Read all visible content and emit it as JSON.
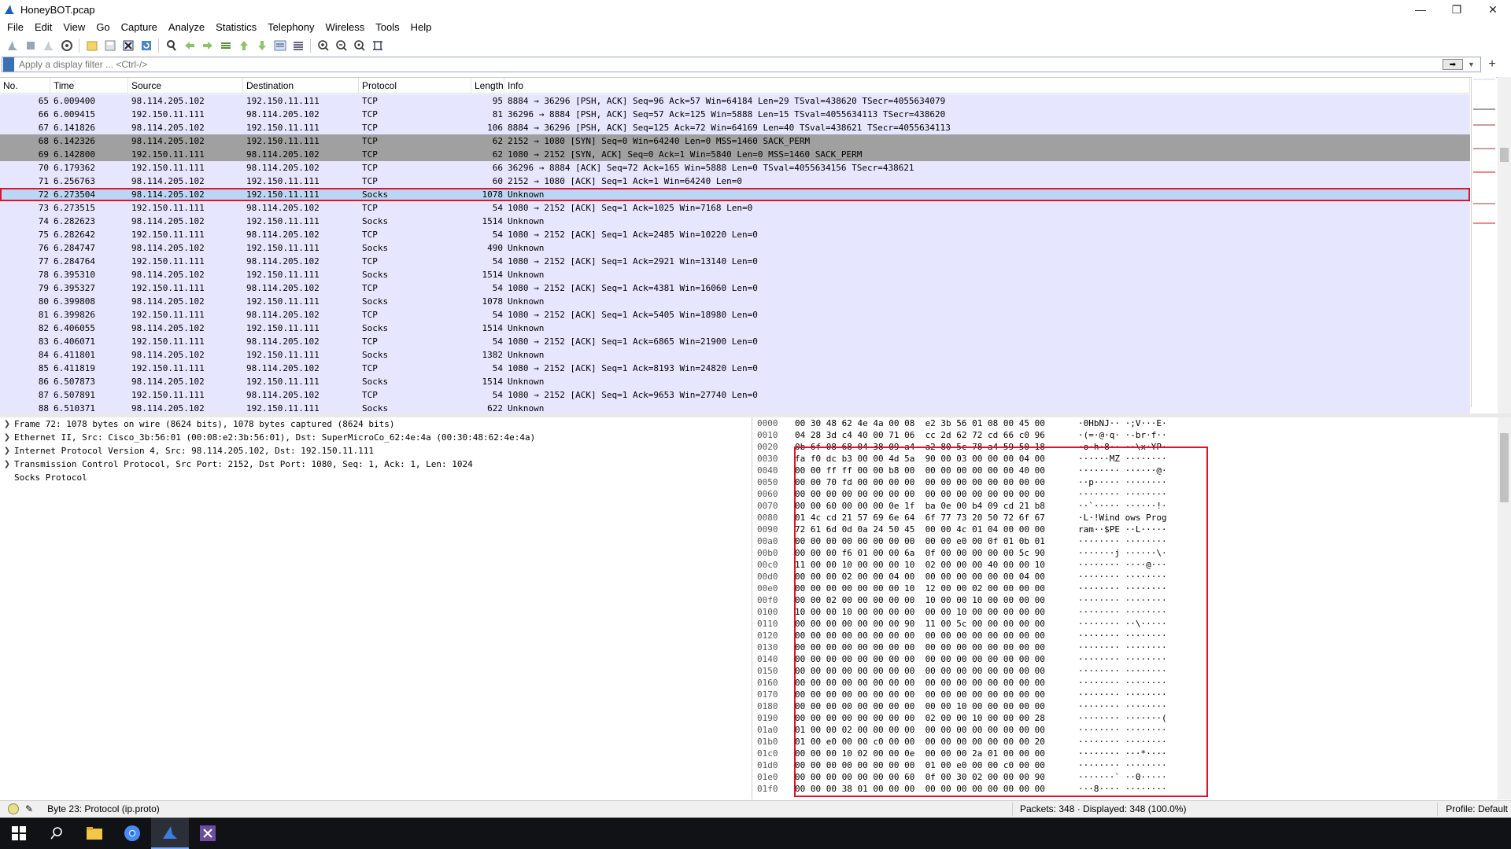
{
  "window": {
    "title": "HoneyBOT.pcap"
  },
  "menu": [
    "File",
    "Edit",
    "View",
    "Go",
    "Capture",
    "Analyze",
    "Statistics",
    "Telephony",
    "Wireless",
    "Tools",
    "Help"
  ],
  "filter": {
    "placeholder": "Apply a display filter ... <Ctrl-/>"
  },
  "packet_list": {
    "columns": [
      "No.",
      "Time",
      "Source",
      "Destination",
      "Protocol",
      "Length",
      "Info"
    ],
    "rows": [
      {
        "no": "65",
        "time": "6.009400",
        "src": "98.114.205.102",
        "dst": "192.150.11.111",
        "proto": "TCP",
        "len": "95",
        "info": "8884 → 36296 [PSH, ACK] Seq=96 Ack=57 Win=64184 Len=29 TSval=438620 TSecr=4055634079",
        "style": "tcp"
      },
      {
        "no": "66",
        "time": "6.009415",
        "src": "192.150.11.111",
        "dst": "98.114.205.102",
        "proto": "TCP",
        "len": "81",
        "info": "36296 → 8884 [PSH, ACK] Seq=57 Ack=125 Win=5888 Len=15 TSval=4055634113 TSecr=438620",
        "style": "tcp"
      },
      {
        "no": "67",
        "time": "6.141826",
        "src": "98.114.205.102",
        "dst": "192.150.11.111",
        "proto": "TCP",
        "len": "106",
        "info": "8884 → 36296 [PSH, ACK] Seq=125 Ack=72 Win=64169 Len=40 TSval=438621 TSecr=4055634113",
        "style": "tcp"
      },
      {
        "no": "68",
        "time": "6.142326",
        "src": "98.114.205.102",
        "dst": "192.150.11.111",
        "proto": "TCP",
        "len": "62",
        "info": "2152 → 1080 [SYN] Seq=0 Win=64240 Len=0 MSS=1460 SACK_PERM",
        "style": "syn"
      },
      {
        "no": "69",
        "time": "6.142800",
        "src": "192.150.11.111",
        "dst": "98.114.205.102",
        "proto": "TCP",
        "len": "62",
        "info": "1080 → 2152 [SYN, ACK] Seq=0 Ack=1 Win=5840 Len=0 MSS=1460 SACK_PERM",
        "style": "syn"
      },
      {
        "no": "70",
        "time": "6.179362",
        "src": "192.150.11.111",
        "dst": "98.114.205.102",
        "proto": "TCP",
        "len": "66",
        "info": "36296 → 8884 [ACK] Seq=72 Ack=165 Win=5888 Len=0 TSval=4055634156 TSecr=438621",
        "style": "tcp"
      },
      {
        "no": "71",
        "time": "6.256763",
        "src": "98.114.205.102",
        "dst": "192.150.11.111",
        "proto": "TCP",
        "len": "60",
        "info": "2152 → 1080 [ACK] Seq=1 Ack=1 Win=64240 Len=0",
        "style": "tcp"
      },
      {
        "no": "72",
        "time": "6.273504",
        "src": "98.114.205.102",
        "dst": "192.150.11.111",
        "proto": "Socks",
        "len": "1078",
        "info": "Unknown",
        "style": "selected"
      },
      {
        "no": "73",
        "time": "6.273515",
        "src": "192.150.11.111",
        "dst": "98.114.205.102",
        "proto": "TCP",
        "len": "54",
        "info": "1080 → 2152 [ACK] Seq=1 Ack=1025 Win=7168 Len=0",
        "style": "tcp"
      },
      {
        "no": "74",
        "time": "6.282623",
        "src": "98.114.205.102",
        "dst": "192.150.11.111",
        "proto": "Socks",
        "len": "1514",
        "info": "Unknown",
        "style": "tcp"
      },
      {
        "no": "75",
        "time": "6.282642",
        "src": "192.150.11.111",
        "dst": "98.114.205.102",
        "proto": "TCP",
        "len": "54",
        "info": "1080 → 2152 [ACK] Seq=1 Ack=2485 Win=10220 Len=0",
        "style": "tcp"
      },
      {
        "no": "76",
        "time": "6.284747",
        "src": "98.114.205.102",
        "dst": "192.150.11.111",
        "proto": "Socks",
        "len": "490",
        "info": "Unknown",
        "style": "tcp"
      },
      {
        "no": "77",
        "time": "6.284764",
        "src": "192.150.11.111",
        "dst": "98.114.205.102",
        "proto": "TCP",
        "len": "54",
        "info": "1080 → 2152 [ACK] Seq=1 Ack=2921 Win=13140 Len=0",
        "style": "tcp"
      },
      {
        "no": "78",
        "time": "6.395310",
        "src": "98.114.205.102",
        "dst": "192.150.11.111",
        "proto": "Socks",
        "len": "1514",
        "info": "Unknown",
        "style": "tcp"
      },
      {
        "no": "79",
        "time": "6.395327",
        "src": "192.150.11.111",
        "dst": "98.114.205.102",
        "proto": "TCP",
        "len": "54",
        "info": "1080 → 2152 [ACK] Seq=1 Ack=4381 Win=16060 Len=0",
        "style": "tcp"
      },
      {
        "no": "80",
        "time": "6.399808",
        "src": "98.114.205.102",
        "dst": "192.150.11.111",
        "proto": "Socks",
        "len": "1078",
        "info": "Unknown",
        "style": "tcp"
      },
      {
        "no": "81",
        "time": "6.399826",
        "src": "192.150.11.111",
        "dst": "98.114.205.102",
        "proto": "TCP",
        "len": "54",
        "info": "1080 → 2152 [ACK] Seq=1 Ack=5405 Win=18980 Len=0",
        "style": "tcp"
      },
      {
        "no": "82",
        "time": "6.406055",
        "src": "98.114.205.102",
        "dst": "192.150.11.111",
        "proto": "Socks",
        "len": "1514",
        "info": "Unknown",
        "style": "tcp"
      },
      {
        "no": "83",
        "time": "6.406071",
        "src": "192.150.11.111",
        "dst": "98.114.205.102",
        "proto": "TCP",
        "len": "54",
        "info": "1080 → 2152 [ACK] Seq=1 Ack=6865 Win=21900 Len=0",
        "style": "tcp"
      },
      {
        "no": "84",
        "time": "6.411801",
        "src": "98.114.205.102",
        "dst": "192.150.11.111",
        "proto": "Socks",
        "len": "1382",
        "info": "Unknown",
        "style": "tcp"
      },
      {
        "no": "85",
        "time": "6.411819",
        "src": "192.150.11.111",
        "dst": "98.114.205.102",
        "proto": "TCP",
        "len": "54",
        "info": "1080 → 2152 [ACK] Seq=1 Ack=8193 Win=24820 Len=0",
        "style": "tcp"
      },
      {
        "no": "86",
        "time": "6.507873",
        "src": "98.114.205.102",
        "dst": "192.150.11.111",
        "proto": "Socks",
        "len": "1514",
        "info": "Unknown",
        "style": "tcp"
      },
      {
        "no": "87",
        "time": "6.507891",
        "src": "192.150.11.111",
        "dst": "98.114.205.102",
        "proto": "TCP",
        "len": "54",
        "info": "1080 → 2152 [ACK] Seq=1 Ack=9653 Win=27740 Len=0",
        "style": "tcp"
      },
      {
        "no": "88",
        "time": "6.510371",
        "src": "98.114.205.102",
        "dst": "192.150.11.111",
        "proto": "Socks",
        "len": "622",
        "info": "Unknown",
        "style": "tcp"
      }
    ]
  },
  "details": [
    {
      "expandable": true,
      "text": "Frame 72: 1078 bytes on wire (8624 bits), 1078 bytes captured (8624 bits)"
    },
    {
      "expandable": true,
      "text": "Ethernet II, Src: Cisco_3b:56:01 (00:08:e2:3b:56:01), Dst: SuperMicroCo_62:4e:4a (00:30:48:62:4e:4a)"
    },
    {
      "expandable": true,
      "text": "Internet Protocol Version 4, Src: 98.114.205.102, Dst: 192.150.11.111"
    },
    {
      "expandable": true,
      "text": "Transmission Control Protocol, Src Port: 2152, Dst Port: 1080, Seq: 1, Ack: 1, Len: 1024"
    },
    {
      "expandable": false,
      "text": "Socks Protocol"
    }
  ],
  "hex": [
    {
      "off": "0000",
      "bytes": "00 30 48 62 4e 4a 00 08  e2 3b 56 01 08 00 45 00",
      "ascii": "·0HbNJ·· ·;V···E·"
    },
    {
      "off": "0010",
      "bytes": "04 28 3d c4 40 00 71 06  cc 2d 62 72 cd 66 c0 96",
      "ascii": "·(=·@·q· ·-br·f··"
    },
    {
      "off": "0020",
      "bytes": "0b 6f 08 68 04 38 09 a4  a2 80 5c 78 a4 59 50 18",
      "ascii": "·o·h·8·· ··\\x·YP·"
    },
    {
      "off": "0030",
      "bytes": "fa f0 dc b3 00 00 4d 5a  90 00 03 00 00 00 04 00",
      "ascii": "······MZ ········"
    },
    {
      "off": "0040",
      "bytes": "00 00 ff ff 00 00 b8 00  00 00 00 00 00 00 40 00",
      "ascii": "········ ······@·"
    },
    {
      "off": "0050",
      "bytes": "00 00 70 fd 00 00 00 00  00 00 00 00 00 00 00 00",
      "ascii": "··p····· ········"
    },
    {
      "off": "0060",
      "bytes": "00 00 00 00 00 00 00 00  00 00 00 00 00 00 00 00",
      "ascii": "········ ········"
    },
    {
      "off": "0070",
      "bytes": "00 00 60 00 00 00 0e 1f  ba 0e 00 b4 09 cd 21 b8",
      "ascii": "··`····· ······!·"
    },
    {
      "off": "0080",
      "bytes": "01 4c cd 21 57 69 6e 64  6f 77 73 20 50 72 6f 67",
      "ascii": "·L·!Wind ows Prog"
    },
    {
      "off": "0090",
      "bytes": "72 61 6d 0d 0a 24 50 45  00 00 4c 01 04 00 00 00",
      "ascii": "ram··$PE ··L·····"
    },
    {
      "off": "00a0",
      "bytes": "00 00 00 00 00 00 00 00  00 00 e0 00 0f 01 0b 01",
      "ascii": "········ ········"
    },
    {
      "off": "00b0",
      "bytes": "00 00 00 f6 01 00 00 6a  0f 00 00 00 00 00 5c 90",
      "ascii": "·······j ······\\·"
    },
    {
      "off": "00c0",
      "bytes": "11 00 00 10 00 00 00 10  02 00 00 00 40 00 00 10",
      "ascii": "········ ····@···"
    },
    {
      "off": "00d0",
      "bytes": "00 00 00 02 00 00 04 00  00 00 00 00 00 00 04 00",
      "ascii": "········ ········"
    },
    {
      "off": "00e0",
      "bytes": "00 00 00 00 00 00 00 10  12 00 00 02 00 00 00 00",
      "ascii": "········ ········"
    },
    {
      "off": "00f0",
      "bytes": "00 00 02 00 00 00 00 00  10 00 00 10 00 00 00 00",
      "ascii": "········ ········"
    },
    {
      "off": "0100",
      "bytes": "10 00 00 10 00 00 00 00  00 00 10 00 00 00 00 00",
      "ascii": "········ ········"
    },
    {
      "off": "0110",
      "bytes": "00 00 00 00 00 00 00 90  11 00 5c 00 00 00 00 00",
      "ascii": "········ ··\\·····"
    },
    {
      "off": "0120",
      "bytes": "00 00 00 00 00 00 00 00  00 00 00 00 00 00 00 00",
      "ascii": "········ ········"
    },
    {
      "off": "0130",
      "bytes": "00 00 00 00 00 00 00 00  00 00 00 00 00 00 00 00",
      "ascii": "········ ········"
    },
    {
      "off": "0140",
      "bytes": "00 00 00 00 00 00 00 00  00 00 00 00 00 00 00 00",
      "ascii": "········ ········"
    },
    {
      "off": "0150",
      "bytes": "00 00 00 00 00 00 00 00  00 00 00 00 00 00 00 00",
      "ascii": "········ ········"
    },
    {
      "off": "0160",
      "bytes": "00 00 00 00 00 00 00 00  00 00 00 00 00 00 00 00",
      "ascii": "········ ········"
    },
    {
      "off": "0170",
      "bytes": "00 00 00 00 00 00 00 00  00 00 00 00 00 00 00 00",
      "ascii": "········ ········"
    },
    {
      "off": "0180",
      "bytes": "00 00 00 00 00 00 00 00  00 00 10 00 00 00 00 00",
      "ascii": "········ ········"
    },
    {
      "off": "0190",
      "bytes": "00 00 00 00 00 00 00 00  02 00 00 10 00 00 00 28",
      "ascii": "········ ·······("
    },
    {
      "off": "01a0",
      "bytes": "01 00 00 02 00 00 00 00  00 00 00 00 00 00 00 00",
      "ascii": "········ ········"
    },
    {
      "off": "01b0",
      "bytes": "01 00 e0 00 00 c0 00 00  00 00 00 00 00 00 00 20",
      "ascii": "········ ········"
    },
    {
      "off": "01c0",
      "bytes": "00 00 00 10 02 00 00 0e  00 00 00 2a 01 00 00 00",
      "ascii": "········ ···*····"
    },
    {
      "off": "01d0",
      "bytes": "00 00 00 00 00 00 00 00  01 00 e0 00 00 c0 00 00",
      "ascii": "········ ········"
    },
    {
      "off": "01e0",
      "bytes": "00 00 00 00 00 00 00 60  0f 00 30 02 00 00 00 90",
      "ascii": "·······` ··0·····"
    },
    {
      "off": "01f0",
      "bytes": "00 00 00 38 01 00 00 00  00 00 00 00 00 00 00 00",
      "ascii": "···8···· ········"
    }
  ],
  "status": {
    "byte_info": "Byte 23: Protocol (ip.proto)",
    "packets": "Packets: 348 · Displayed: 348 (100.0%)",
    "profile": "Profile: Default"
  },
  "colors": {
    "tcp_row": "#e7e6ff",
    "syn_row": "#a0a0a0",
    "selected_row": "#bcd7f5",
    "highlight_box": "#d9142b"
  }
}
